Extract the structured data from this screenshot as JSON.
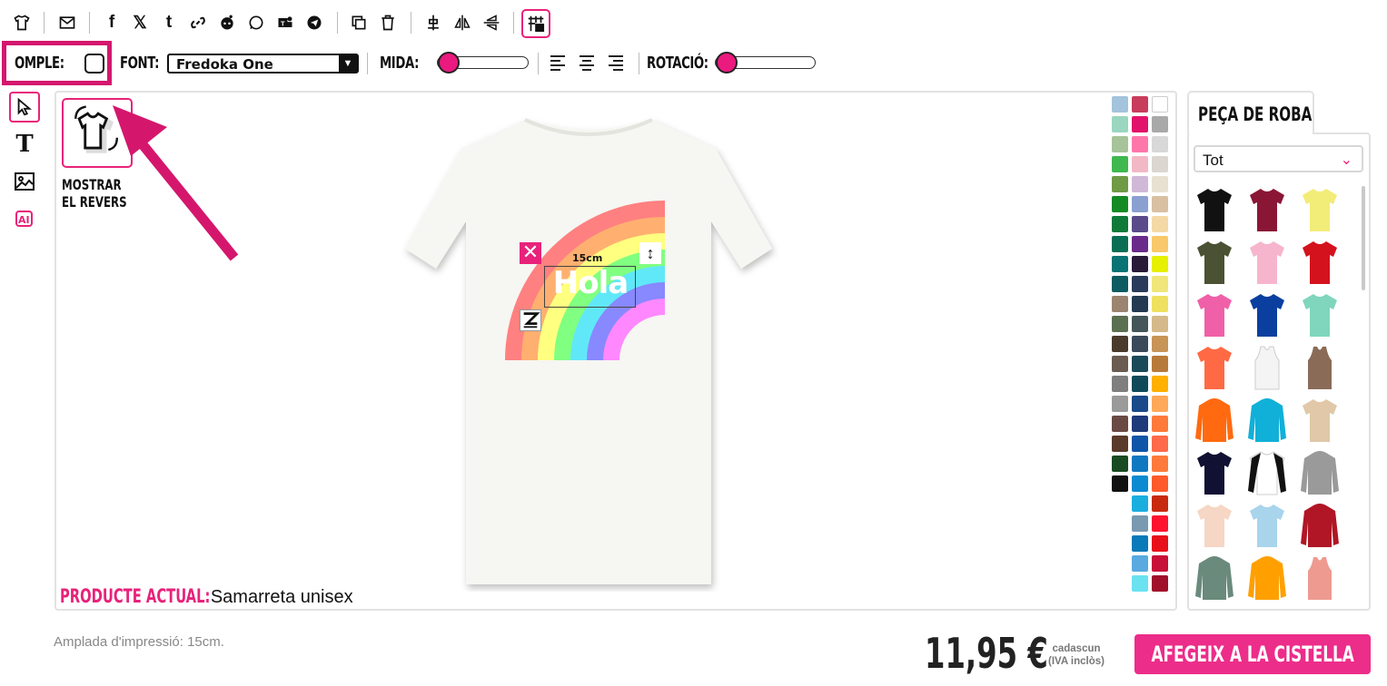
{
  "toolbar": {
    "icons": [
      "tshirt-icon",
      "mail-icon",
      "facebook-icon",
      "x-icon",
      "tumblr-icon",
      "link-icon",
      "reddit-icon",
      "whatsapp-icon",
      "teams-icon",
      "telegram-icon",
      "duplicate-icon",
      "trash-icon",
      "center-align-icon",
      "flip-horizontal-icon",
      "flip-vertical-icon",
      "grid-icon"
    ]
  },
  "options": {
    "fill_label": "OMPLE:",
    "font_label": "FONT:",
    "font_value": "Fredoka One",
    "size_label": "MIDA:",
    "rotation_label": "ROTACIÓ:",
    "size_slider_value": 0.0,
    "rotation_slider_value": 0.0
  },
  "canvas": {
    "show_back_label": "MOSTRAR EL REVERS",
    "design_text": "Hola",
    "width_badge": "15cm",
    "product_label": "PRODUCTE ACTUAL:",
    "product_name": "Samarreta unisex",
    "accent": "#e8227a"
  },
  "swatches": {
    "col1": [
      "#a3c4dc",
      "#9ad6c0",
      "#a6c39a",
      "#3fb850",
      "#6f9a46",
      "#148a25",
      "#0f7a3a",
      "#0a6e55",
      "#0a7373",
      "#0e5b62",
      "#9b8570",
      "#5b7050",
      "#4a3a2c",
      "#6a5c50",
      "#7f7f7f",
      "#9a9a9a",
      "#6a4a44",
      "#5a3a2a",
      "#1a4a22",
      "#111111"
    ],
    "col2": [
      "#c83c5c",
      "#e2136a",
      "#ff77aa",
      "#f2b8c6",
      "#d0b8d8",
      "#8aa0d0",
      "#5a4a8a",
      "#6a2a8a",
      "#2a1a3a",
      "#2a3a5a",
      "#233a52",
      "#44565a",
      "#3a4a5a",
      "#1a4a5a",
      "#104a5a",
      "#1a4a8a",
      "#1e3a7a",
      "#0f55a8",
      "#0f78c0",
      "#0a8ad0",
      "#1aaedf",
      "#7a9ab2",
      "#0a7ab8",
      "#5aaae0",
      "#6ae2f0"
    ],
    "col3": [
      "#ffffff",
      "#a9a9a9",
      "#d8d8d8",
      "#dcd6d0",
      "#e8e0d0",
      "#d9c0a2",
      "#f4d9a6",
      "#f8c86a",
      "#e6f000",
      "#f0e67a",
      "#f0e060",
      "#d6b98a",
      "#c89458",
      "#b87a3a",
      "#ffb000",
      "#ffa85a",
      "#ff7a3a",
      "#ff6a4a",
      "#ff7a3a",
      "#ff5a2a",
      "#c82a10",
      "#ff1430",
      "#e8101a",
      "#c81038",
      "#a0102a",
      "#6a1a34"
    ]
  },
  "panel": {
    "tab_label": "PEÇA DE ROBA",
    "category_value": "Tot"
  },
  "footer": {
    "print_width": "Amplada d'impressió: 15cm.",
    "price": "11,95 €",
    "each_line1": "cadascun",
    "each_line2": "(IVA inclòs)",
    "cart_button": "AFEGEIX A LA CISTELLA"
  }
}
